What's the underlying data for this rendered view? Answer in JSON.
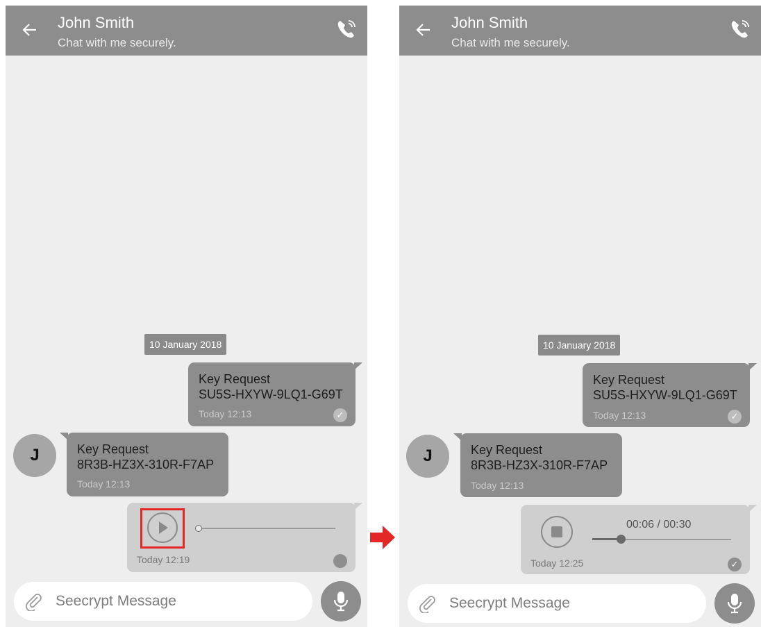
{
  "colors": {
    "header": "#8d8d8d",
    "chat_bg": "#eeeeee",
    "bubble": "#8d8d8d",
    "voice_bubble": "#cfcfcf",
    "highlight": "#e32626",
    "arrow": "#e32626"
  },
  "screens": [
    {
      "header": {
        "title": "John Smith",
        "subtitle": "Chat with me securely.",
        "back_icon": "arrow-left-icon",
        "call_icon": "phone-icon"
      },
      "date_chip": "10 January 2018",
      "sent_message": {
        "line1": "Key Request",
        "line2": "SU5S-HXYW-9LQ1-G69T",
        "time": "Today 12:13",
        "status_icon": "check-icon"
      },
      "received_message": {
        "avatar": "J",
        "line1": "Key Request",
        "line2": "8R3B-HZ3X-310R-F7AP",
        "time": "Today 12:13"
      },
      "voice_message": {
        "state": "paused",
        "control_icon": "play-icon",
        "time": "Today 12:19",
        "progress": 0,
        "highlighted": true
      },
      "input": {
        "placeholder": "Seecrypt Message",
        "attach_icon": "paperclip-icon",
        "mic_icon": "microphone-icon"
      }
    },
    {
      "header": {
        "title": "John Smith",
        "subtitle": "Chat with me securely.",
        "back_icon": "arrow-left-icon",
        "call_icon": "phone-icon"
      },
      "date_chip": "10 January 2018",
      "sent_message": {
        "line1": "Key Request",
        "line2": "SU5S-HXYW-9LQ1-G69T",
        "time": "Today 12:13",
        "status_icon": "check-icon"
      },
      "received_message": {
        "avatar": "J",
        "line1": "Key Request",
        "line2": "8R3B-HZ3X-310R-F7AP",
        "time": "Today 12:13"
      },
      "voice_message": {
        "state": "playing",
        "control_icon": "stop-icon",
        "time": "Today 12:25",
        "duration_display": "00:06 / 00:30",
        "progress": 0.2,
        "status_icon": "check-icon"
      },
      "input": {
        "placeholder": "Seecrypt Message",
        "attach_icon": "paperclip-icon",
        "mic_icon": "microphone-icon"
      }
    }
  ],
  "transition_icon": "arrow-right-icon"
}
